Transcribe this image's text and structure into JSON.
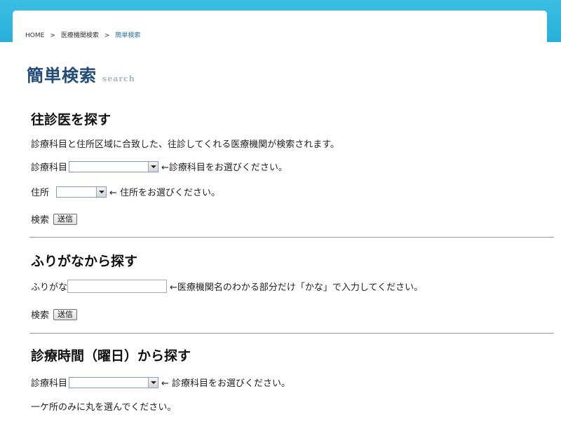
{
  "breadcrumb": {
    "home": "HOME",
    "separator": ">",
    "level2": "医療機関検索",
    "current": "簡単検索"
  },
  "page": {
    "title": "簡単検索",
    "subtitle": "search"
  },
  "section1": {
    "heading": "往診医を探す",
    "description": "診療科目と住所区域に合致した、往診してくれる医療機関が検索されます。",
    "dept_label": "診療科目",
    "dept_value": "",
    "dept_hint": "←診療科目をお選びください。",
    "address_label": "住所",
    "address_value": "",
    "address_hint": "← 住所をお選びください。",
    "search_label": "検索",
    "submit_label": "送信"
  },
  "section2": {
    "heading": "ふりがなから探す",
    "kana_label": "ふりがな",
    "kana_value": "",
    "kana_hint": "←医療機関名のわかる部分だけ「かな」で入力してください。",
    "search_label": "検索",
    "submit_label": "送信"
  },
  "section3": {
    "heading": "診療時間（曜日）から探す",
    "dept_label": "診療科目",
    "dept_value": "",
    "dept_hint": "← 診療科目をお選びください。",
    "partial_note": "一ケ所のみに丸を選んでください。"
  },
  "colors": {
    "header_band": "#2fb6df",
    "title": "#1f4a7a",
    "breadcrumb_current": "#2a6f9f"
  }
}
